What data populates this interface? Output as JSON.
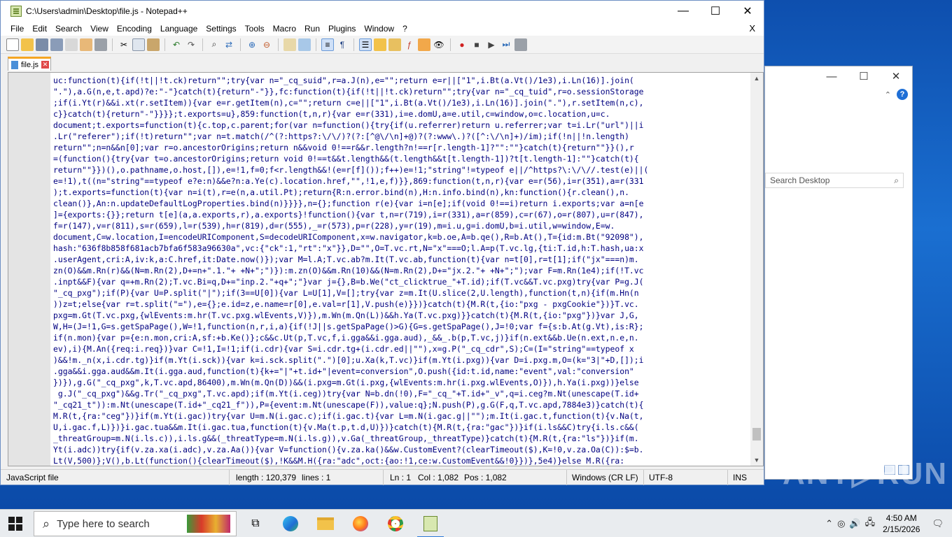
{
  "window": {
    "title": "C:\\Users\\admin\\Desktop\\file.js - Notepad++",
    "minimize": "—",
    "maximize": "☐",
    "close": "✕"
  },
  "menu": [
    "File",
    "Edit",
    "Search",
    "View",
    "Encoding",
    "Language",
    "Settings",
    "Tools",
    "Macro",
    "Run",
    "Plugins",
    "Window",
    "?"
  ],
  "menu_close": "X",
  "tab": {
    "label": "file.js",
    "close": "✕"
  },
  "editor_lines": [
    "uc:function(t){if(!t||!t.ck)return\"\";try{var n=\"_cq_suid\",r=a.J(n),e=\"\";return e=r||[\"1\",i.Bt(a.Vt()/1e3),i.Ln(16)].join(",
    "\".\"),a.G(n,e,t.apd)?e:\"-\"}catch(t){return\"-\"}},fc:function(t){if(!t||!t.ck)return\"\";try{var n=\"_cq_tuid\",r=o.sessionStorage",
    ";if(i.Yt(r)&&i.xt(r.setItem)){var e=r.getItem(n),c=\"\";return c=e||[\"1\",i.Bt(a.Vt()/1e3),i.Ln(16)].join(\".\"),r.setItem(n,c),",
    "c}}catch(t){return\"-\"}}}};t.exports=u},859:function(t,n,r){var e=r(331),i=e.domU,a=e.util,c=window,o=c.location,u=c.",
    "document;t.exports=function(t){c.top,c.parent;for(var n=function(){try{if(u.referrer)return u.referrer;var t=i.Lr(\"url\")||i",
    ".Lr(\"referer\");if(!t)return\"\";var n=t.match(/^(?:https?:\\/\\/)?(?:[^@\\/\\n]+@)?(?:www\\.)?([^:\\/\\n]+)/im);if(!n||!n.length)",
    "return\"\";n=n&&n[0];var r=o.ancestorOrigins;return n&&void 0!==r&&r.length?n!==r[r.length-1]?\"\":\"\"}catch(t){return\"\"}}(),r",
    "=(function(){try{var t=o.ancestorOrigins;return void 0!==t&&t.length&&(t.length&&t[t.length-1])?t[t.length-1]:\"\"}catch(t){",
    "return\"\"}})(),o.pathname,o.host,[]),e=!1,f=0;f<r.length&&!(e=r[f]());f++)e=!1;\"string\"!=typeof e||/^https?\\:\\/\\//.test(e)||(",
    "e=!1),t((n=\"string\"==typeof e?e:n)&&e?n:a.Ye(c).location.href,\"\",!1,e,f)}},869:function(t,n,r){var e=r(56),i=r(351),a=r(331",
    ");t.exports=function(t){var n=i(t),r=e(n,a.util.Pt);return{R:n.error.bind(n),H:n.info.bind(n),kn:function(){r.clean(),n.",
    "clean()},An:n.updateDefaultLogProperties.bind(n)}}}},n={};function r(e){var i=n[e];if(void 0!==i)return i.exports;var a=n[e",
    "]={exports:{}};return t[e](a,a.exports,r),a.exports}!function(){var t,n=r(719),i=r(331),a=r(859),c=r(67),o=r(807),u=r(847),",
    "f=r(147),v=r(811),s=r(659),l=r(539),h=r(819),d=r(555),_=r(573),p=r(228),y=r(19),m=i.u,g=i.domU,b=i.util,w=window,E=w.",
    "document,C=w.location,I=encodeURIComponent,S=decodeURIComponent,x=w.navigator,k=b.oe,A=b.qe(),R=b.At(),T={id:m.Bt(\"92098\"),",
    "hash:\"636f8b858f681acb7bfa6f583a96630a\",vc:{\"ck\":1,\"rt\":\"x\"}},D=\"\",O=T.vc.rt,N=\"x\"===O;l.A=p(T.vc.lg,{ti:T.id,h:T.hash,ua:x",
    ".userAgent,cri:A,iv:k,a:C.href,it:Date.now()});var M=l.A;T.vc.ab?m.It(T.vc.ab,function(t){var n=t[0],r=t[1];if(\"jx\"===n)m.",
    "zn(O)&&m.Rn(r)&&(N=m.Rn(2),D+=n+\".1.\"+ +N+\";\")}):m.zn(O)&&m.Rn(10)&&(N=m.Rn(2),D+=\"jx.2.\"+ +N+\";\");var F=m.Rn(1e4);if(!T.vc",
    ".inpt&&F){var q=+m.Rn(2);T.vc.Bi=q,D+=\"inp.2.\"+q+\";\"}var j={},B=b.We(\"ct_clicktrue_\"+T.id);if(T.vc&&T.vc.pxg)try{var P=g.J(",
    "\"_cq_pxg\");if(P){var U=P.split(\"|\");if(3==U[0]){var L=U[1],V=[];try{var z=m.It(U.slice(2,U.length),function(t,n){if(m.Hn(n",
    "))z=t;else{var r=t.split(\"=\"),e={};e.id=z,e.name=r[0],e.val=r[1],V.push(e)}})}catch(t){M.R(t,{io:\"pxg - pxgCookie\"})}T.vc.",
    "pxg=m.Gt(T.vc.pxg,{wlEvents:m.hr(T.vc.pxg.wlEvents,V)}),m.Wn(m.Qn(L))&&h.Ya(T.vc.pxg)}}catch(t){M.R(t,{io:\"pxg\"})}var J,G,",
    "W,H=(J=!1,G=s.getSpaPage(),W=!1,function(n,r,i,a){if(!J||s.getSpaPage()>G){G=s.getSpaPage(),J=!0;var f={s:b.At(g.Vt),is:R};",
    "if(n.mon){var p={e:n.mon,cri:A,sf:+b.Ke()};c&&c.Ut(p,T.vc,f,i.gga&&i.gga.aud),_&&_.b(p,T.vc,j)}if(n.ext&&b.Ue(n.ext,n.e,n.",
    "ev),i){M.An({req:i.req})}var C=!1,I=!1;if(i.cdr){var S=i.cdr.tg+(i.cdr.ed||\"\"),x=g.P(\"_cq_cdr\",S);C=(I=\"string\"==typeof x",
    ")&&!m._n(x,i.cdr.tg)}if(m.Yt(i.sck)){var k=i.sck.split(\".\")[0];u.Xa(k,T.vc)}if(m.Yt(i.pxg)){var D=i.pxg.m,O=(k=\"3|\"+D,[]);i",
    ".gga&&i.gga.aud&&m.It(i.gga.aud,function(t){k+=\"|\"+t.id+\"|event=conversion\",O.push({id:t.id,name:\"event\",val:\"conversion\"",
    "})}),g.G(\"_cq_pxg\",k,T.vc.apd,86400),m.Wn(m.Qn(D))&&(i.pxg=m.Gt(i.pxg,{wlEvents:m.hr(i.pxg.wlEvents,O)}),h.Ya(i.pxg))}else",
    " g.J(\"_cq_pxg\")&&g.Tr(\"_cq_pxg\",T.vc.apd);if(m.Yt(i.ceg))try{var N=b.dn(!0),F=\"_cq_\"+T.id+\"_v\",q=i.ceg?m.Nt(unescape(T.id+",
    "\"_cq21_t\")):m.Nt(unescape(T.id+\"_cq21_f\")),P={event:m.Nt(unescape(F)),value:q};N.push(P),g.G(F,q,T.vc.apd,7884e3)}catch(t){",
    "M.R(t,{ra:\"ceg\"})}if(m.Yt(i.gac))try{var U=m.N(i.gac.c);if(i.gac.t){var L=m.N(i.gac.g||\"\");m.It(i.gac.t,function(t){v.Na(t,",
    "U,i.gac.f,L)})}i.gac.tua&&m.It(i.gac.tua,function(t){v.Ma(t.p,t.d,U)})}catch(t){M.R(t,{ra:\"gac\"})}if(i.ls&&C)try{i.ls.c&&(",
    "_threatGroup=m.N(i.ls.c)),i.ls.g&&(_threatType=m.N(i.ls.g)),v.Ga(_threatGroup,_threatType)}catch(t){M.R(t,{ra:\"ls\"})}if(m.",
    "Yt(i.adc))try{if(v.za.xa(i.adc),v.za.Aa()){var V=function(){v.za.ka()&&w.CustomEvent?(clearTimeout($),K=!0,v.za.Oa(C)):$=b.",
    "Lt(V,500)};V(),b.Lt(function(){clearTimeout($),!K&&M.H({ra:\"adc\",oct:{ao:!1,ce:w.CustomEvent&&!0}})},5e4)}else M.R({ra:"
  ],
  "status": {
    "type": "JavaScript file",
    "length": "length : 120,379",
    "lines": "lines : 1",
    "ln": "Ln : 1",
    "col": "Col : 1,082",
    "pos": "Pos : 1,082",
    "eol": "Windows (CR LF)",
    "enc": "UTF-8",
    "mode": "INS"
  },
  "explorer": {
    "search_placeholder": "Search Desktop",
    "help": "?"
  },
  "watermark": "ANY▷RUN",
  "taskbar": {
    "search_placeholder": "Type here to search",
    "time": "4:50 AM",
    "date": "2/15/2026"
  },
  "colors": {
    "accent": "#2b79d8",
    "desktop": "#1a6fd1",
    "code_text": "#000080",
    "tab_accent": "#f5a623"
  }
}
